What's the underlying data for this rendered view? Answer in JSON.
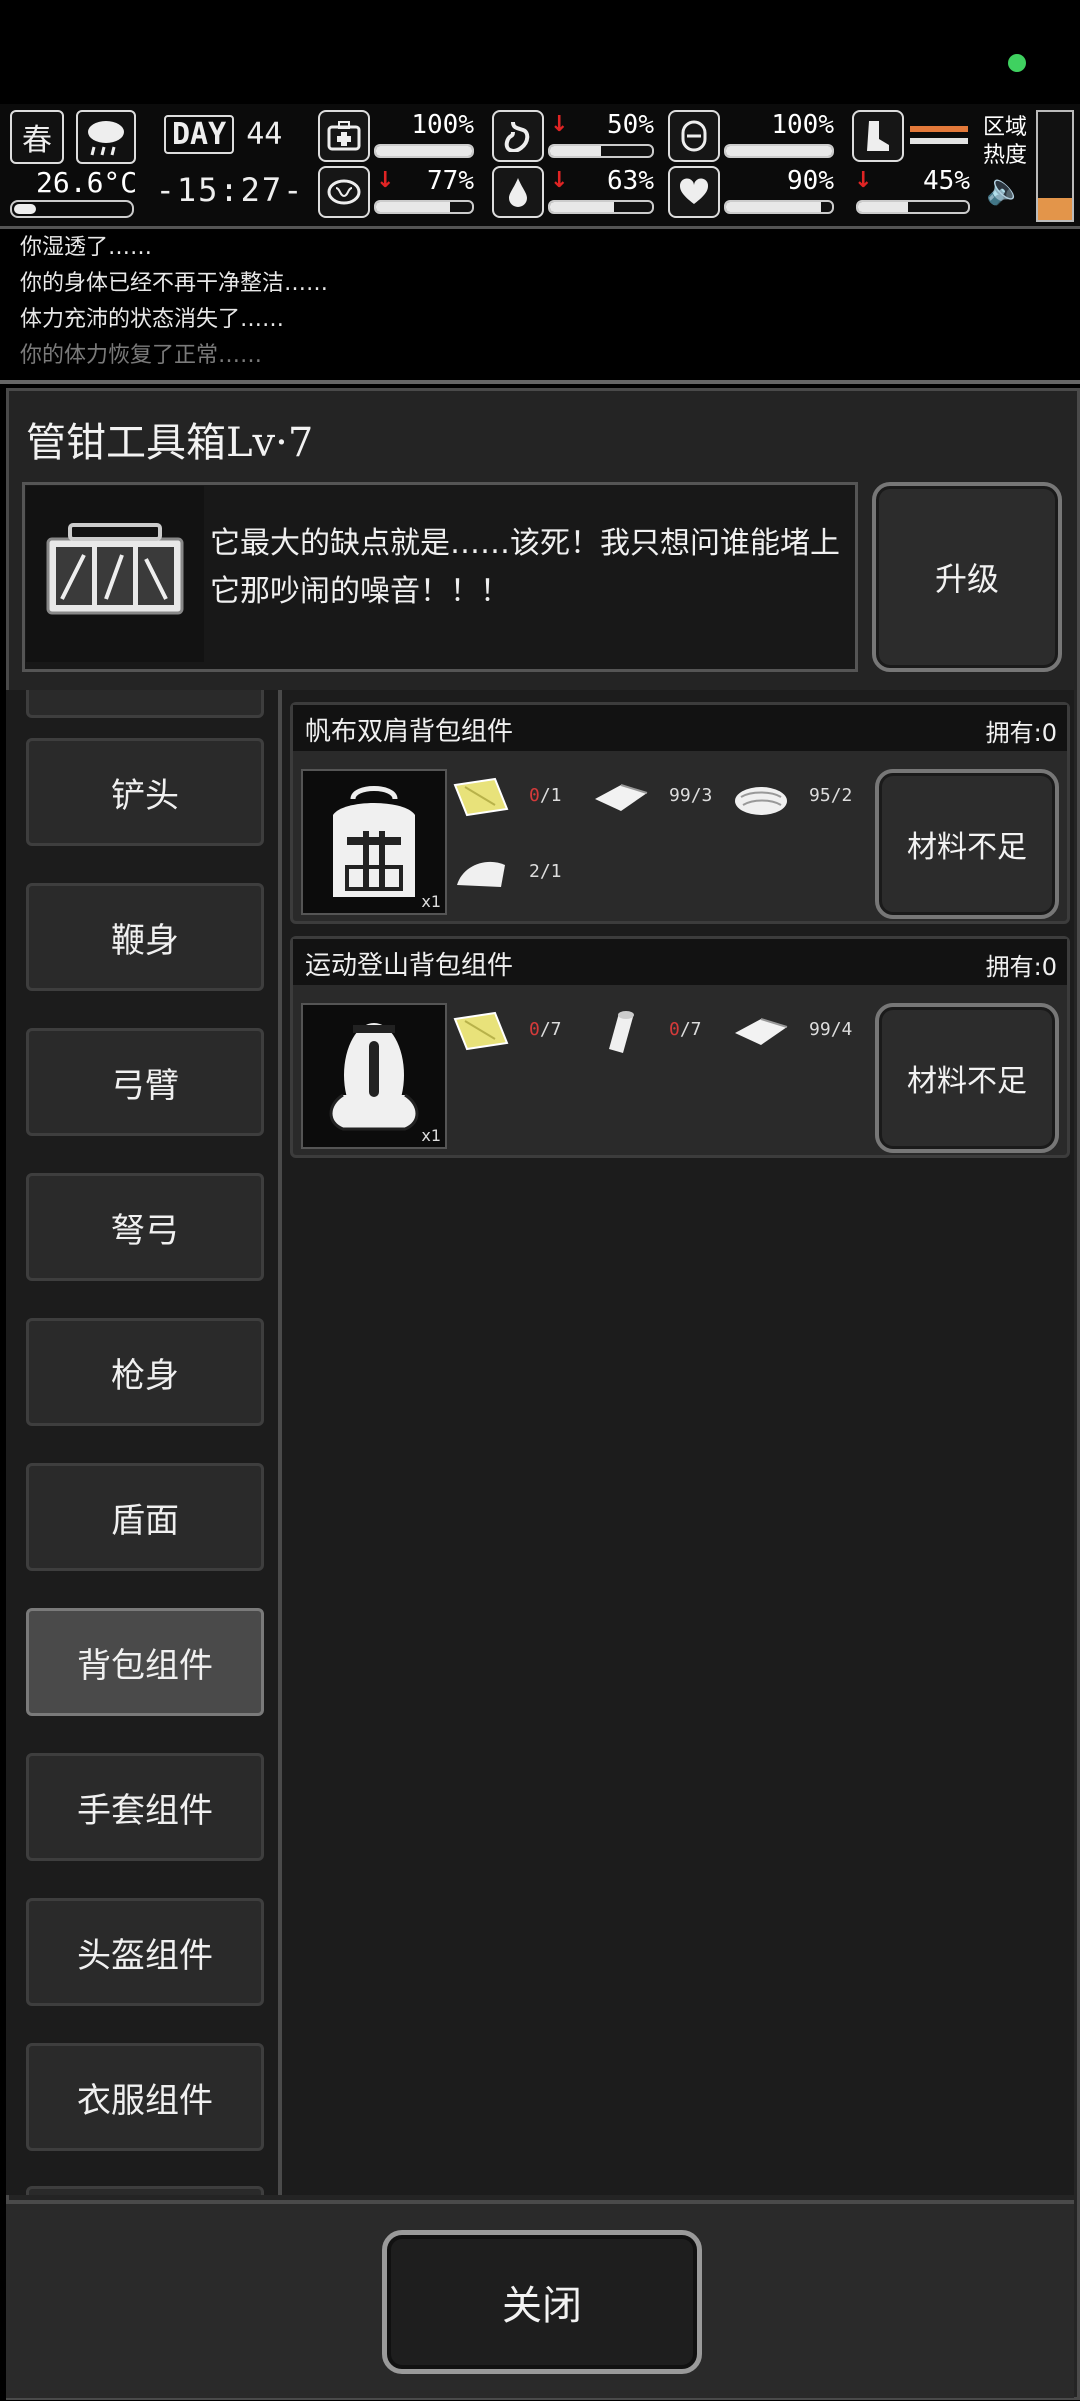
{
  "status_bar": {
    "indicator_color": "#3fd160"
  },
  "hud": {
    "season": "春",
    "weather_icon": "rain-cloud-icon",
    "temperature": "26.6°C",
    "day_label": "DAY",
    "day_number": "44",
    "clock": "-15:27-",
    "stats": [
      {
        "name": "health",
        "icon": "medkit-icon",
        "value": "100%",
        "fraction": 1.0,
        "down": false
      },
      {
        "name": "hunger",
        "icon": "stomach-icon",
        "value": "50%",
        "fraction": 0.5,
        "down": true
      },
      {
        "name": "bladder",
        "icon": "bladder-icon",
        "value": "100%",
        "fraction": 1.0,
        "down": false
      },
      {
        "name": "brain",
        "icon": "brain-icon",
        "value": "77%",
        "fraction": 0.77,
        "down": true
      },
      {
        "name": "thirst",
        "icon": "water-drop-icon",
        "value": "63%",
        "fraction": 0.63,
        "down": true
      },
      {
        "name": "mood",
        "icon": "heart-icon",
        "value": "90%",
        "fraction": 0.9,
        "down": false
      },
      {
        "name": "stamina",
        "icon": "boot-icon",
        "value": "45%",
        "fraction": 0.45,
        "down": true
      }
    ],
    "region_label": "区域热度",
    "region_heat_fraction": 0.2,
    "heat_color": "#e3954a"
  },
  "log": [
    {
      "text": "你湿透了……",
      "faded": false
    },
    {
      "text": "你的身体已经不再干净整洁……",
      "faded": false
    },
    {
      "text": "体力充沛的状态消失了……",
      "faded": false
    },
    {
      "text": "你的体力恢复了正常……",
      "faded": true
    }
  ],
  "panel": {
    "title": "管钳工具箱Lv·7",
    "description": "它最大的缺点就是……该死！我只想问谁能堵上它那吵闹的噪音！！！",
    "upgrade_label": "升级"
  },
  "categories": [
    {
      "label": "铲头",
      "selected": false
    },
    {
      "label": "鞭身",
      "selected": false
    },
    {
      "label": "弓臂",
      "selected": false
    },
    {
      "label": "弩弓",
      "selected": false
    },
    {
      "label": "枪身",
      "selected": false
    },
    {
      "label": "盾面",
      "selected": false
    },
    {
      "label": "背包组件",
      "selected": true
    },
    {
      "label": "手套组件",
      "selected": false
    },
    {
      "label": "头盔组件",
      "selected": false
    },
    {
      "label": "衣服组件",
      "selected": false
    }
  ],
  "recipes": [
    {
      "name": "帆布双肩背包组件",
      "owned": "拥有:0",
      "yield": "x1",
      "materials": [
        {
          "icon": "yellow-cloth-icon",
          "have": "0",
          "need": "/1",
          "low": true
        },
        {
          "icon": "folded-cloth-icon",
          "have": "99",
          "need": "/3",
          "low": false
        },
        {
          "icon": "cloth-pile-icon",
          "have": "95",
          "need": "/2",
          "low": false
        },
        {
          "icon": "white-rag-icon",
          "have": "2",
          "need": "/1",
          "low": false
        }
      ],
      "button": "材料不足"
    },
    {
      "name": "运动登山背包组件",
      "owned": "拥有:0",
      "yield": "x1",
      "materials": [
        {
          "icon": "yellow-cloth-icon",
          "have": "0",
          "need": "/7",
          "low": true
        },
        {
          "icon": "fabric-roll-icon",
          "have": "0",
          "need": "/7",
          "low": true
        },
        {
          "icon": "folded-cloth-icon",
          "have": "99",
          "need": "/4",
          "low": false
        }
      ],
      "button": "材料不足"
    }
  ],
  "close_label": "关闭"
}
